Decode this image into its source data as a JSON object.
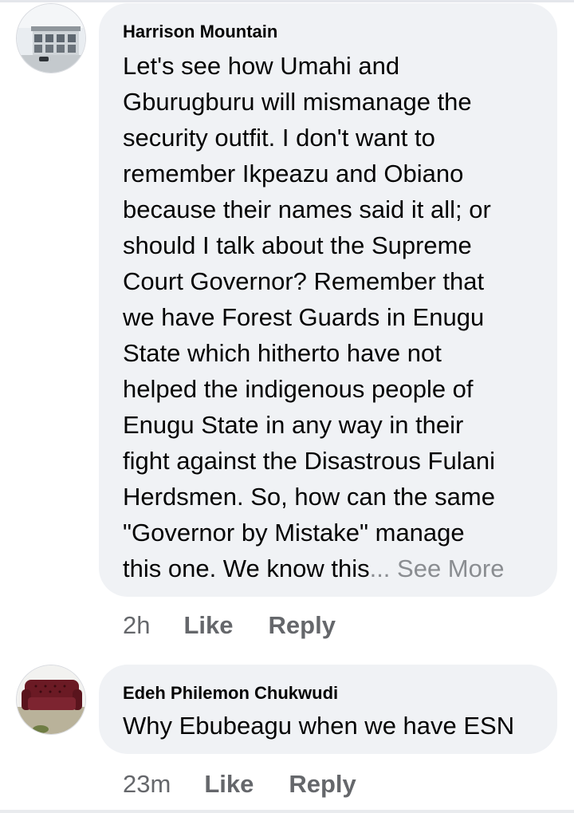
{
  "comments": [
    {
      "author": "Harrison Mountain",
      "avatar_icon": "building-photo-avatar",
      "text": "Let's see how Umahi and\nGburugburu will mismanage the\nsecurity outfit. I don't want to\nremember Ikpeazu and Obiano\nbecause their names said it all; or\nshould I talk about the Supreme\nCourt Governor? Remember that\nwe have Forest Guards in Enugu\nState which hitherto have not\nhelped the indigenous people of\nEnugu State in any way in their\nfight against the Disastrous Fulani\nHerdsmen. So, how can the same\n\"Governor by Mistake\" manage\nthis one. We know this",
      "ellipsis": "... ",
      "see_more": "See More",
      "time": "2h",
      "like": "Like",
      "reply": "Reply"
    },
    {
      "author": "Edeh Philemon Chukwudi",
      "avatar_icon": "sofa-photo-avatar",
      "text": "Why Ebubeagu when we have ESN",
      "time": "23m",
      "like": "Like",
      "reply": "Reply"
    }
  ]
}
